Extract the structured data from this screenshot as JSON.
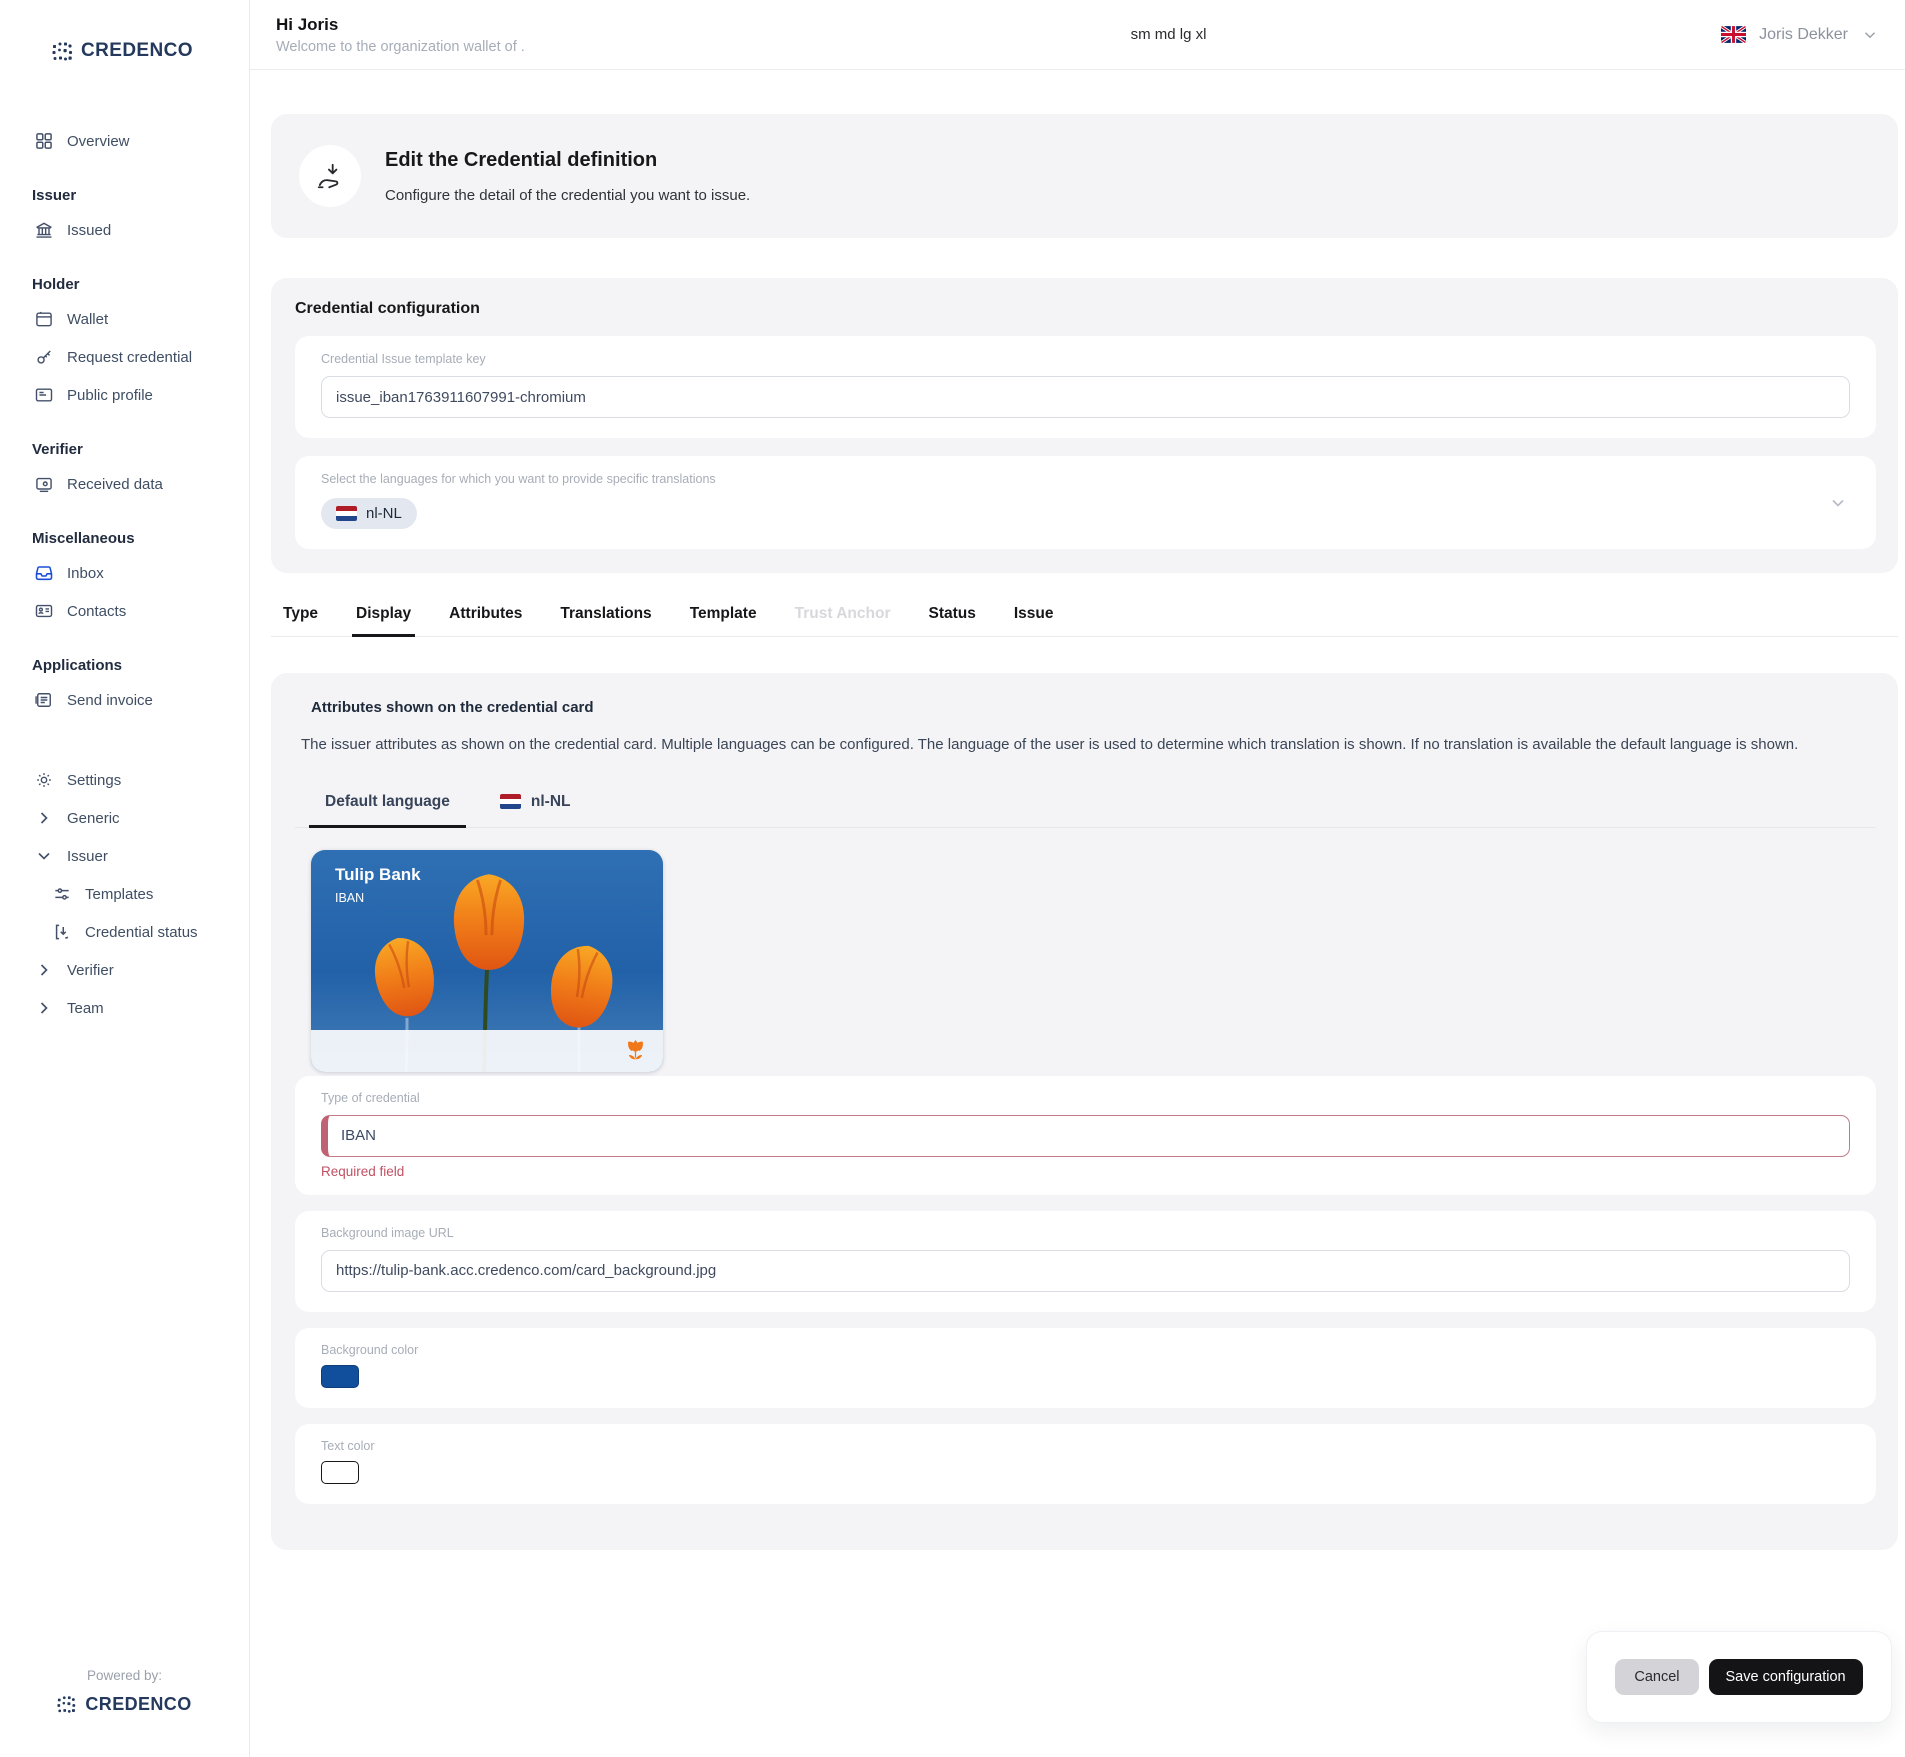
{
  "brand": {
    "name": "CREDENCO",
    "powered_by_label": "Powered by:"
  },
  "topbar": {
    "greeting": "Hi Joris",
    "welcome": "Welcome to the organization wallet of .",
    "center_text": "sm md lg xl",
    "user_name": "Joris Dekker"
  },
  "sidebar": {
    "items": [
      {
        "label": "Overview",
        "type": "item",
        "icon": "grid-icon"
      },
      {
        "label": "Issuer",
        "type": "section"
      },
      {
        "label": "Issued",
        "type": "item",
        "icon": "bank-icon"
      },
      {
        "label": "Holder",
        "type": "section"
      },
      {
        "label": "Wallet",
        "type": "item",
        "icon": "wallet-icon"
      },
      {
        "label": "Request credential",
        "type": "item",
        "icon": "key-icon"
      },
      {
        "label": "Public profile",
        "type": "item",
        "icon": "id-card-icon"
      },
      {
        "label": "Verifier",
        "type": "section"
      },
      {
        "label": "Received data",
        "type": "item",
        "icon": "received-data-icon"
      },
      {
        "label": "Miscellaneous",
        "type": "section"
      },
      {
        "label": "Inbox",
        "type": "item",
        "icon": "inbox-icon",
        "icon_color": "#1d4ed8"
      },
      {
        "label": "Contacts",
        "type": "item",
        "icon": "contacts-icon"
      },
      {
        "label": "Applications",
        "type": "section"
      },
      {
        "label": "Send invoice",
        "type": "item",
        "icon": "invoice-icon"
      },
      {
        "label": "Settings",
        "type": "item",
        "icon": "gear-icon"
      },
      {
        "label": "Generic",
        "type": "item",
        "icon": "chevron-right-icon",
        "collapsed": true
      },
      {
        "label": "Issuer",
        "type": "item",
        "icon": "chevron-down-icon",
        "expanded": true
      },
      {
        "label": "Templates",
        "type": "subitem",
        "icon": "sliders-icon"
      },
      {
        "label": "Credential status",
        "type": "subitem",
        "icon": "status-icon"
      },
      {
        "label": "Verifier",
        "type": "item",
        "icon": "chevron-right-icon",
        "collapsed": true
      },
      {
        "label": "Team",
        "type": "item",
        "icon": "chevron-right-icon",
        "collapsed": true
      }
    ]
  },
  "hero": {
    "title": "Edit the Credential definition",
    "subtitle": "Configure the detail of the credential you want to issue."
  },
  "config": {
    "title": "Credential configuration",
    "template_key": {
      "label": "Credential Issue template key",
      "value": "issue_iban1763911607991-chromium"
    },
    "languages": {
      "label": "Select the languages for which you want to provide specific translations",
      "selected": "nl-NL"
    }
  },
  "tabs": [
    {
      "label": "Type"
    },
    {
      "label": "Display",
      "active": true
    },
    {
      "label": "Attributes"
    },
    {
      "label": "Translations"
    },
    {
      "label": "Template"
    },
    {
      "label": "Trust Anchor",
      "disabled": true
    },
    {
      "label": "Status"
    },
    {
      "label": "Issue"
    }
  ],
  "display_panel": {
    "title": "Attributes shown on the credential card",
    "description": "The issuer attributes as shown on the credential card. Multiple languages can be configured. The language of the user is used to determine which translation is shown. If no translation is available the default language is shown.",
    "language_tabs": [
      {
        "label": "Default language",
        "active": true
      },
      {
        "label": "nl-NL"
      }
    ],
    "card_preview": {
      "issuer": "Tulip Bank",
      "credential_type": "IBAN"
    },
    "fields": {
      "type_of_credential": {
        "label": "Type of credential",
        "value": "IBAN",
        "error": "Required field"
      },
      "background_image_url": {
        "label": "Background image URL",
        "value": "https://tulip-bank.acc.credenco.com/card_background.jpg"
      },
      "background_color": {
        "label": "Background color",
        "value": "#114e9b"
      },
      "text_color": {
        "label": "Text color",
        "value": "#ffffff"
      }
    }
  },
  "actions": {
    "cancel": "Cancel",
    "save": "Save configuration"
  },
  "colors": {
    "card_blue": "#2b67ac",
    "tulip_orange": "#f07818",
    "error_red": "#bf5a6b",
    "accent_swatch_blue": "#114e9b",
    "logo_navy": "#24395c",
    "inbox_icon_blue": "#1d4ed8"
  },
  "icons": {
    "logo-mark-icon": "dot-matrix",
    "uk-flag-icon": "union-jack",
    "nl-flag-icon": "red-white-blue stripes",
    "hand-receive-icon": "hand with down arrow",
    "tulip-logo-icon": "orange tulip",
    "chevron-down-icon": "v",
    "chevron-right-icon": ">"
  }
}
